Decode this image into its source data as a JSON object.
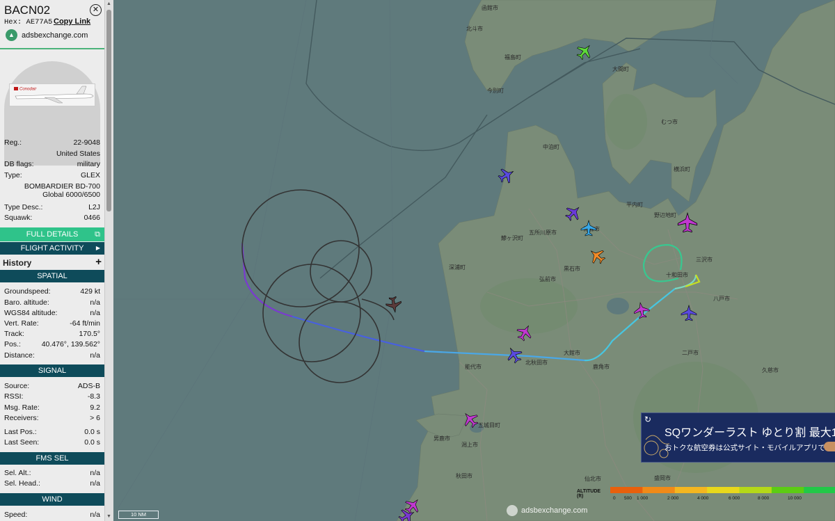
{
  "aircraft": {
    "callsign": "BACN02",
    "hex_label": "Hex:",
    "hex": "AE77A5",
    "copy_link": "Copy Link",
    "source_site": "adsbexchange.com",
    "photo_livery_text": "Conodair"
  },
  "details": {
    "reg_label": "Reg.:",
    "reg": "22-9048",
    "country": "United States",
    "dbflags_label": "DB flags:",
    "dbflags": "military",
    "type_label": "Type:",
    "type": "GLEX",
    "model_line1": "BOMBARDIER BD-700",
    "model_line2": "Global 6000/6500",
    "typedesc_label": "Type Desc.:",
    "typedesc": "L2J",
    "squawk_label": "Squawk:",
    "squawk": "0466"
  },
  "buttons": {
    "full_details": "FULL DETAILS",
    "flight_activity": "FLIGHT ACTIVITY",
    "history": "History"
  },
  "spatial": {
    "header": "SPATIAL",
    "groundspeed_label": "Groundspeed:",
    "groundspeed": "429 kt",
    "baro_label": "Baro. altitude:",
    "baro": "n/a",
    "wgs_label": "WGS84 altitude:",
    "wgs": "n/a",
    "vrate_label": "Vert. Rate:",
    "vrate": "-64 ft/min",
    "track_label": "Track:",
    "track": "170.5°",
    "pos_label": "Pos.:",
    "pos": "40.476°, 139.562°",
    "distance_label": "Distance:",
    "distance": "n/a"
  },
  "signal": {
    "header": "SIGNAL",
    "source_label": "Source:",
    "source": "ADS-B",
    "rssi_label": "RSSI:",
    "rssi": "-8.3",
    "msgrate_label": "Msg. Rate:",
    "msgrate": "9.2",
    "receivers_label": "Receivers:",
    "receivers": "> 6",
    "lastpos_label": "Last Pos.:",
    "lastpos": "0.0 s",
    "lastseen_label": "Last Seen:",
    "lastseen": "0.0 s"
  },
  "fms": {
    "header": "FMS SEL",
    "selalt_label": "Sel. Alt.:",
    "selalt": "n/a",
    "selhead_label": "Sel. Head.:",
    "selhead": "n/a"
  },
  "wind": {
    "header": "WIND",
    "speed_label": "Speed:",
    "speed": "n/a"
  },
  "map": {
    "place_labels": [
      "函館市",
      "北斗市",
      "福島町",
      "今別町",
      "大間町",
      "むつ市",
      "中泊町",
      "青森市",
      "五所川原市",
      "横浜町",
      "平内町",
      "野辺地町",
      "鯵ヶ沢町",
      "深浦町",
      "弘前市",
      "黒石市",
      "八戸市",
      "三沢市",
      "十和田市",
      "大館市",
      "鹿角市",
      "能代市",
      "北秋田市",
      "五城目町",
      "男鹿市",
      "潟上市",
      "秋田市",
      "仙北市",
      "盛岡市",
      "二戸市",
      "久慈市"
    ],
    "scale": "10 NM",
    "watermark": "adsbexchange.com",
    "altitude_label": "ALTITUDE (ft)",
    "altitude_ticks": [
      "0",
      "500",
      "1 000",
      "2 000",
      "4 000",
      "6 000",
      "8 000",
      "10 000"
    ],
    "altitude_colors": [
      "#e8600c",
      "#f08a18",
      "#f4b620",
      "#e8d81c",
      "#b4d818",
      "#5ccc14",
      "#22c848",
      "#2ac8a0"
    ],
    "ad_title": "SQワンダーラスト ゆとり割 最大1",
    "ad_subtitle": "おトクな航空券は公式サイト・モバイルアプリで"
  }
}
